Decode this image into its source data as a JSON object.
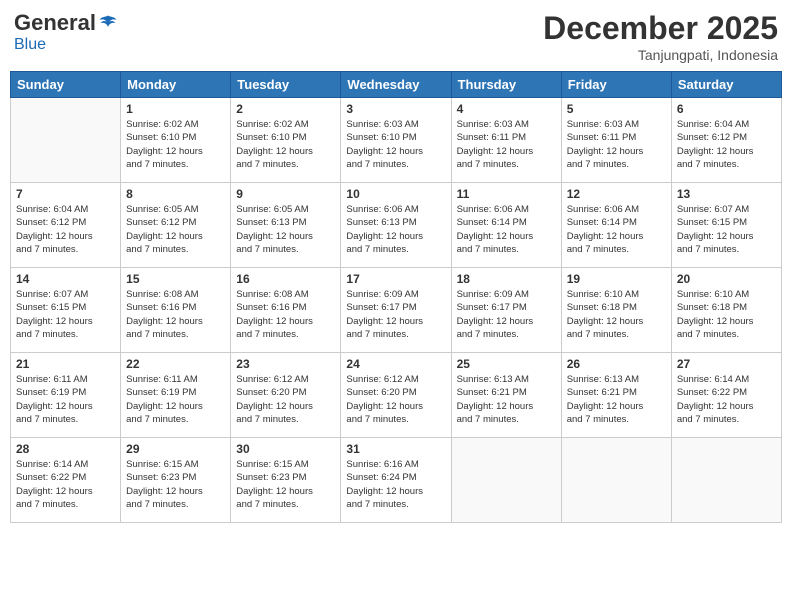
{
  "logo": {
    "general": "General",
    "blue": "Blue"
  },
  "title": "December 2025",
  "location": "Tanjungpati, Indonesia",
  "days_of_week": [
    "Sunday",
    "Monday",
    "Tuesday",
    "Wednesday",
    "Thursday",
    "Friday",
    "Saturday"
  ],
  "weeks": [
    [
      {
        "day": "",
        "info": ""
      },
      {
        "day": "1",
        "info": "Sunrise: 6:02 AM\nSunset: 6:10 PM\nDaylight: 12 hours\nand 7 minutes."
      },
      {
        "day": "2",
        "info": "Sunrise: 6:02 AM\nSunset: 6:10 PM\nDaylight: 12 hours\nand 7 minutes."
      },
      {
        "day": "3",
        "info": "Sunrise: 6:03 AM\nSunset: 6:10 PM\nDaylight: 12 hours\nand 7 minutes."
      },
      {
        "day": "4",
        "info": "Sunrise: 6:03 AM\nSunset: 6:11 PM\nDaylight: 12 hours\nand 7 minutes."
      },
      {
        "day": "5",
        "info": "Sunrise: 6:03 AM\nSunset: 6:11 PM\nDaylight: 12 hours\nand 7 minutes."
      },
      {
        "day": "6",
        "info": "Sunrise: 6:04 AM\nSunset: 6:12 PM\nDaylight: 12 hours\nand 7 minutes."
      }
    ],
    [
      {
        "day": "7",
        "info": "Sunrise: 6:04 AM\nSunset: 6:12 PM\nDaylight: 12 hours\nand 7 minutes."
      },
      {
        "day": "8",
        "info": "Sunrise: 6:05 AM\nSunset: 6:12 PM\nDaylight: 12 hours\nand 7 minutes."
      },
      {
        "day": "9",
        "info": "Sunrise: 6:05 AM\nSunset: 6:13 PM\nDaylight: 12 hours\nand 7 minutes."
      },
      {
        "day": "10",
        "info": "Sunrise: 6:06 AM\nSunset: 6:13 PM\nDaylight: 12 hours\nand 7 minutes."
      },
      {
        "day": "11",
        "info": "Sunrise: 6:06 AM\nSunset: 6:14 PM\nDaylight: 12 hours\nand 7 minutes."
      },
      {
        "day": "12",
        "info": "Sunrise: 6:06 AM\nSunset: 6:14 PM\nDaylight: 12 hours\nand 7 minutes."
      },
      {
        "day": "13",
        "info": "Sunrise: 6:07 AM\nSunset: 6:15 PM\nDaylight: 12 hours\nand 7 minutes."
      }
    ],
    [
      {
        "day": "14",
        "info": "Sunrise: 6:07 AM\nSunset: 6:15 PM\nDaylight: 12 hours\nand 7 minutes."
      },
      {
        "day": "15",
        "info": "Sunrise: 6:08 AM\nSunset: 6:16 PM\nDaylight: 12 hours\nand 7 minutes."
      },
      {
        "day": "16",
        "info": "Sunrise: 6:08 AM\nSunset: 6:16 PM\nDaylight: 12 hours\nand 7 minutes."
      },
      {
        "day": "17",
        "info": "Sunrise: 6:09 AM\nSunset: 6:17 PM\nDaylight: 12 hours\nand 7 minutes."
      },
      {
        "day": "18",
        "info": "Sunrise: 6:09 AM\nSunset: 6:17 PM\nDaylight: 12 hours\nand 7 minutes."
      },
      {
        "day": "19",
        "info": "Sunrise: 6:10 AM\nSunset: 6:18 PM\nDaylight: 12 hours\nand 7 minutes."
      },
      {
        "day": "20",
        "info": "Sunrise: 6:10 AM\nSunset: 6:18 PM\nDaylight: 12 hours\nand 7 minutes."
      }
    ],
    [
      {
        "day": "21",
        "info": "Sunrise: 6:11 AM\nSunset: 6:19 PM\nDaylight: 12 hours\nand 7 minutes."
      },
      {
        "day": "22",
        "info": "Sunrise: 6:11 AM\nSunset: 6:19 PM\nDaylight: 12 hours\nand 7 minutes."
      },
      {
        "day": "23",
        "info": "Sunrise: 6:12 AM\nSunset: 6:20 PM\nDaylight: 12 hours\nand 7 minutes."
      },
      {
        "day": "24",
        "info": "Sunrise: 6:12 AM\nSunset: 6:20 PM\nDaylight: 12 hours\nand 7 minutes."
      },
      {
        "day": "25",
        "info": "Sunrise: 6:13 AM\nSunset: 6:21 PM\nDaylight: 12 hours\nand 7 minutes."
      },
      {
        "day": "26",
        "info": "Sunrise: 6:13 AM\nSunset: 6:21 PM\nDaylight: 12 hours\nand 7 minutes."
      },
      {
        "day": "27",
        "info": "Sunrise: 6:14 AM\nSunset: 6:22 PM\nDaylight: 12 hours\nand 7 minutes."
      }
    ],
    [
      {
        "day": "28",
        "info": "Sunrise: 6:14 AM\nSunset: 6:22 PM\nDaylight: 12 hours\nand 7 minutes."
      },
      {
        "day": "29",
        "info": "Sunrise: 6:15 AM\nSunset: 6:23 PM\nDaylight: 12 hours\nand 7 minutes."
      },
      {
        "day": "30",
        "info": "Sunrise: 6:15 AM\nSunset: 6:23 PM\nDaylight: 12 hours\nand 7 minutes."
      },
      {
        "day": "31",
        "info": "Sunrise: 6:16 AM\nSunset: 6:24 PM\nDaylight: 12 hours\nand 7 minutes."
      },
      {
        "day": "",
        "info": ""
      },
      {
        "day": "",
        "info": ""
      },
      {
        "day": "",
        "info": ""
      }
    ]
  ]
}
